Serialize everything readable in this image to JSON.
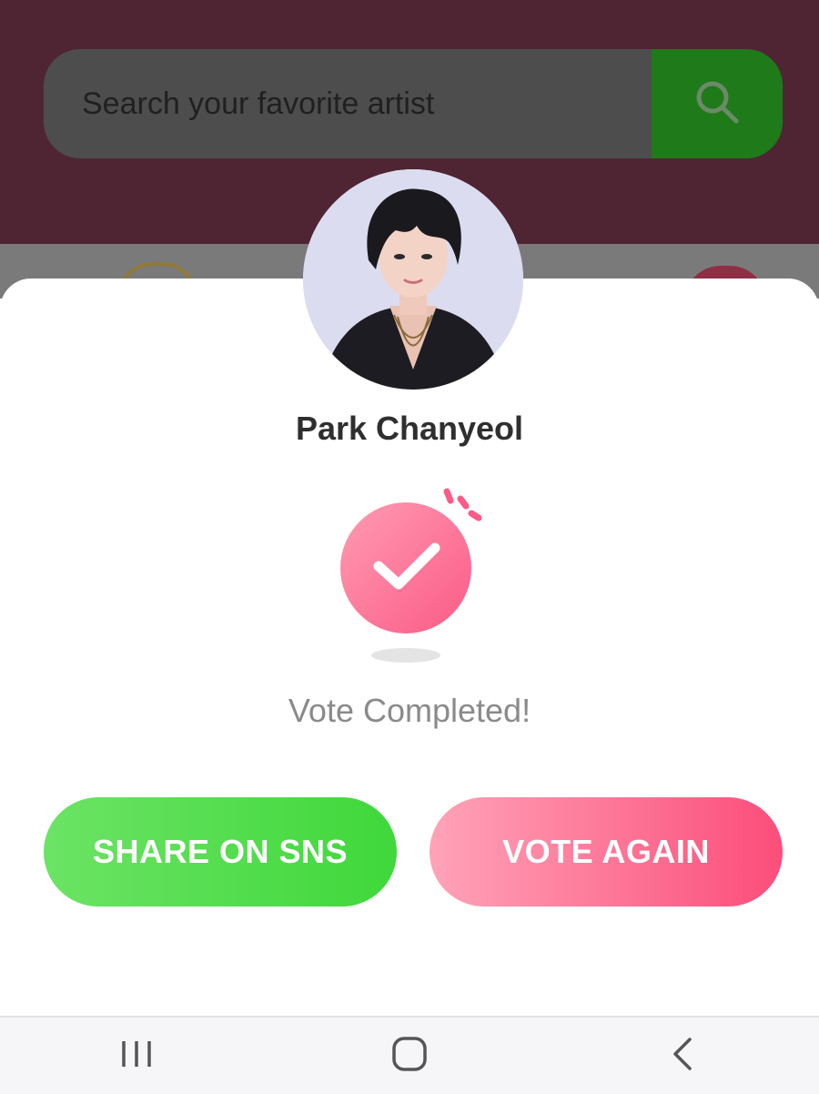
{
  "search": {
    "placeholder": "Search your favorite artist",
    "icon": "search-icon"
  },
  "artist": {
    "name": "Park Chanyeol"
  },
  "vote": {
    "status": "Vote Completed!",
    "icon": "checkmark-icon"
  },
  "actions": {
    "share_label": "SHARE ON SNS",
    "vote_again_label": "VOTE AGAIN"
  },
  "navbar": {
    "items": [
      "recent-apps-icon",
      "home-icon",
      "back-icon"
    ]
  },
  "colors": {
    "header_bg": "#4f2533",
    "search_button": "#1f7a1a",
    "accent_pink": "#fb5b86",
    "accent_green": "#3fd83a",
    "name_text": "#2f2f2f",
    "status_text": "#8a8a8a"
  }
}
